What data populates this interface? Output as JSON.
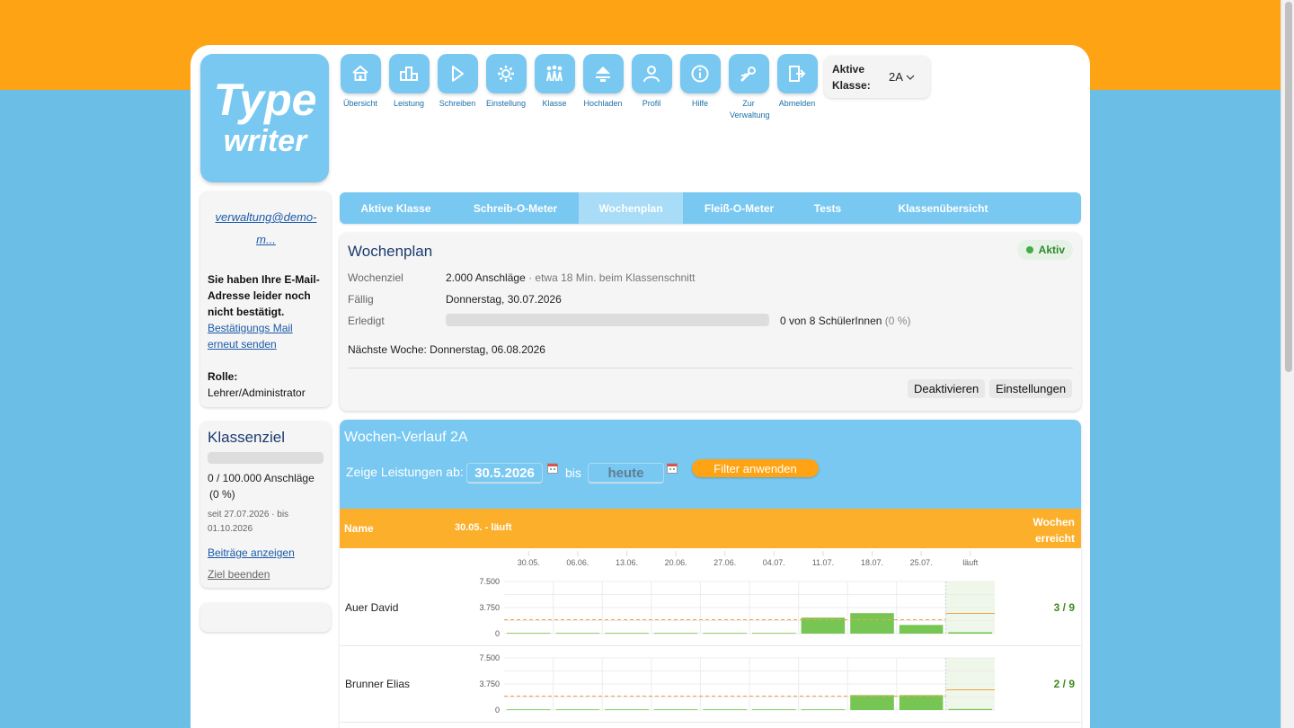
{
  "app": {
    "logo_line1": "Type",
    "logo_line2": "writer"
  },
  "nav": [
    {
      "label": "Übersicht",
      "icon": "house-icon"
    },
    {
      "label": "Leistung",
      "icon": "podium-icon"
    },
    {
      "label": "Schreiben",
      "icon": "play-icon"
    },
    {
      "label": "Einstellung",
      "icon": "gear-icon"
    },
    {
      "label": "Klasse",
      "icon": "people-icon"
    },
    {
      "label": "Hochladen",
      "icon": "upload-icon"
    },
    {
      "label": "Profil",
      "icon": "person-icon"
    },
    {
      "label": "Hilfe",
      "icon": "info-icon"
    },
    {
      "label": "Zur Verwaltung",
      "icon": "wrench-icon"
    },
    {
      "label": "Abmelden",
      "icon": "logout-icon"
    }
  ],
  "klasse": {
    "label": "Aktive Klasse:",
    "value": "2A"
  },
  "user": {
    "email": "verwaltung@demo-m...",
    "warning": "Sie haben Ihre E-Mail-Adresse leider noch nicht bestätigt.",
    "resend_link": "Bestätigungs Mail erneut senden",
    "role_label": "Rolle:",
    "role": "Lehrer/Administrator"
  },
  "klassenziel": {
    "title": "Klassenziel",
    "progress": 0,
    "count": "0 / 100.000 Anschläge",
    "percent": "(0 %)",
    "date_range": "seit 27.07.2026  · bis 01.10.2026",
    "link_beitraege": "Beiträge anzeigen",
    "link_beenden": "Ziel beenden"
  },
  "tabs": [
    {
      "label": "Aktive Klasse",
      "active": false
    },
    {
      "label": "Schreib-O-Meter",
      "active": false
    },
    {
      "label": "Wochenplan",
      "active": true
    },
    {
      "label": "Fleiß-O-Meter",
      "active": false
    },
    {
      "label": "Tests",
      "active": false
    },
    {
      "label": "Klassenübersicht",
      "active": false
    }
  ],
  "wochenplan": {
    "title": "Wochenplan",
    "status": "Aktiv",
    "ziel_label": "Wochenziel",
    "ziel_value": "2.000 Anschläge",
    "ziel_note": " · etwa 18 Min. beim Klassenschnitt",
    "faellig_label": "Fällig",
    "faellig_value": "Donnerstag, 30.07.2026",
    "erledigt_label": "Erledigt",
    "erledigt_progress": 0,
    "erledigt_value": "0 von 8 SchülerInnen",
    "erledigt_pct": "(0 %)",
    "naechste": "Nächste Woche: Donnerstag, 06.08.2026",
    "btn_deaktivieren": "Deaktivieren",
    "btn_einstellungen": "Einstellungen"
  },
  "verlauf": {
    "title": "Wochen-Verlauf 2A",
    "filter_label": "Zeige Leistungen ab:",
    "from": "30.5.2026",
    "bis": "bis",
    "to": "heute",
    "filter_button": "Filter anwenden",
    "col_name": "Name",
    "col_range": "30.05. - läuft",
    "col_wochen": "Wochen erreicht"
  },
  "chart_data": {
    "type": "bar",
    "categories": [
      "30.05.",
      "06.06.",
      "13.06.",
      "20.06.",
      "27.06.",
      "04.07.",
      "11.07.",
      "18.07.",
      "25.07.",
      "läuft"
    ],
    "y_ticks": [
      "7.500",
      "3.750",
      "0"
    ],
    "ylim": [
      0,
      7500
    ],
    "target": 2000,
    "series": [
      {
        "name": "Auer David",
        "values": [
          0,
          0,
          0,
          0,
          0,
          0,
          2300,
          2950,
          1250,
          200
        ],
        "ratio": "3 / 9"
      },
      {
        "name": "Brunner Elias",
        "values": [
          0,
          0,
          0,
          0,
          0,
          0,
          0,
          2150,
          2150,
          150
        ],
        "ratio": "2 / 9"
      }
    ],
    "colors": {
      "bar": "#77c653",
      "target": "#f3a04a",
      "current_bg": "#eef7ea"
    }
  }
}
